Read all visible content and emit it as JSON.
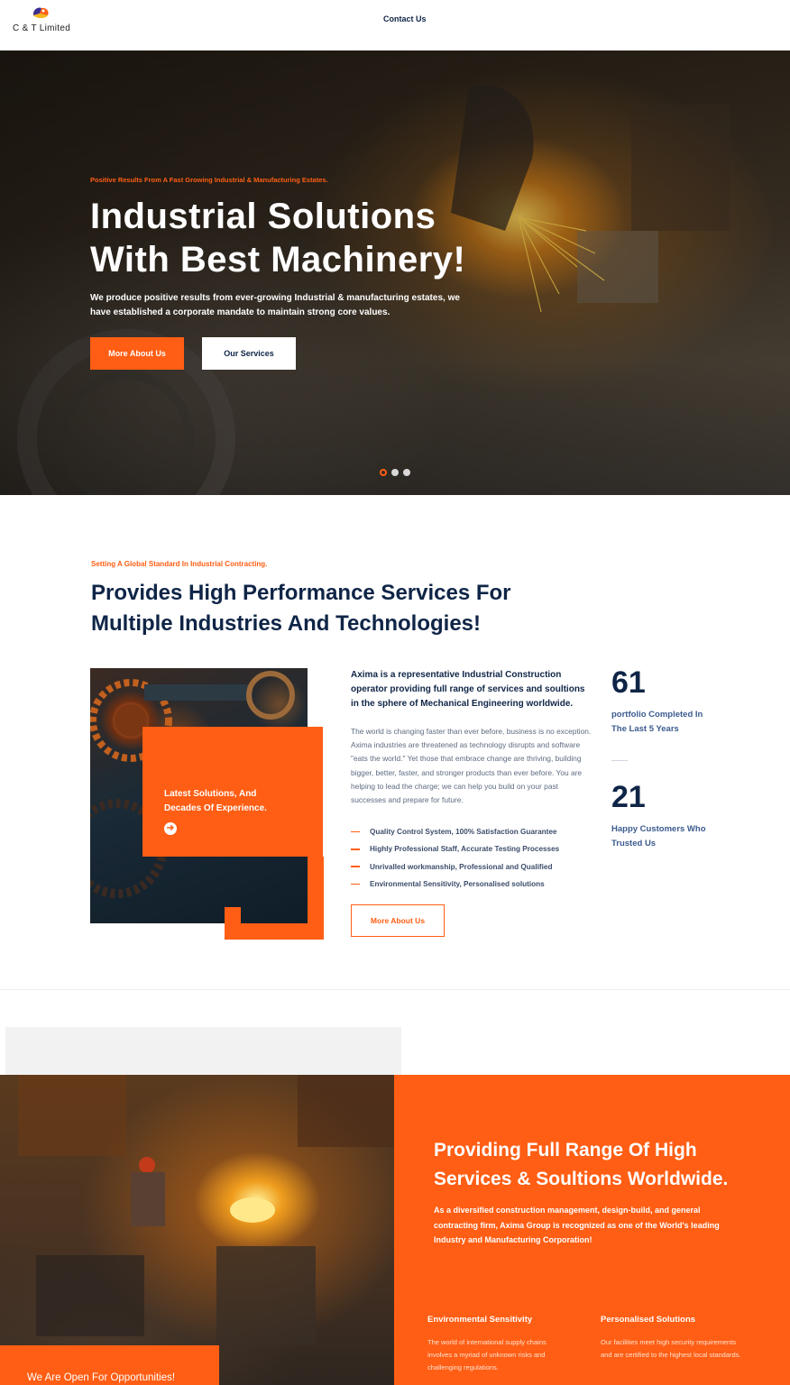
{
  "header": {
    "logo_text": "C & T  Limited",
    "nav_contact": "Contact Us"
  },
  "hero": {
    "kicker": "Positive Results From A Fast Growing Industrial & Manufacturing Estates.",
    "title_line1": "Industrial Solutions",
    "title_line2": "With Best Machinery!",
    "subtitle": "We produce positive results from ever-growing Industrial & manufacturing estates, we have established a corporate mandate to maintain strong core values.",
    "btn_primary": "More About Us",
    "btn_secondary": "Our Services",
    "slides": 3,
    "active_slide": 1
  },
  "about": {
    "kicker": "Setting A Global Standard In Industrial Contracting.",
    "title_line1": "Provides High Performance Services For",
    "title_line2": "Multiple Industries And Technologies!",
    "card_text": "Latest Solutions, And Decades Of Experience.",
    "lead": "Axima is a representative Industrial Construction operator providing full range of services and soultions in the sphere of Mechanical Engineering worldwide.",
    "body": "The world is changing faster than ever before, business is no exception. Axima industries are threatened as technology disrupts and software \"eats the world.\" Yet those that embrace change are thriving, building bigger, better, faster, and stronger products than ever before. You are helping to lead the charge; we can help you build on your past successes and prepare for future.",
    "features": [
      "Quality Control System, 100% Satisfaction Guarantee",
      "Highly Professional Staff, Accurate Testing Processes",
      "Unrivalled workmanship, Professional and Qualified",
      "Environmental Sensitivity, Personalised solutions"
    ],
    "btn": "More About Us",
    "stats": [
      {
        "number": "61",
        "label": "portfolio Completed In The Last 5 Years"
      },
      {
        "number": "21",
        "label": "Happy Customers Who Trusted Us"
      }
    ]
  },
  "services": {
    "opportunities": "We Are Open For Opportunities!",
    "title": "Providing Full Range Of High Services & Soultions Worldwide.",
    "desc": "As a diversified construction management, design-build, and general contracting firm, Axima Group is recognized as one of the World's leading Industry and Manufacturing Corporation!",
    "columns": [
      {
        "title": "Environmental Sensitivity",
        "text": "The world of international supply chains involves a myriad of unknown risks and challenging regulations."
      },
      {
        "title": "Personalised Solutions",
        "text": "Our facilities meet high security requirements and are certified to the highest local standards."
      }
    ]
  },
  "colors": {
    "accent": "#ff5e14",
    "navy": "#0f2547"
  }
}
